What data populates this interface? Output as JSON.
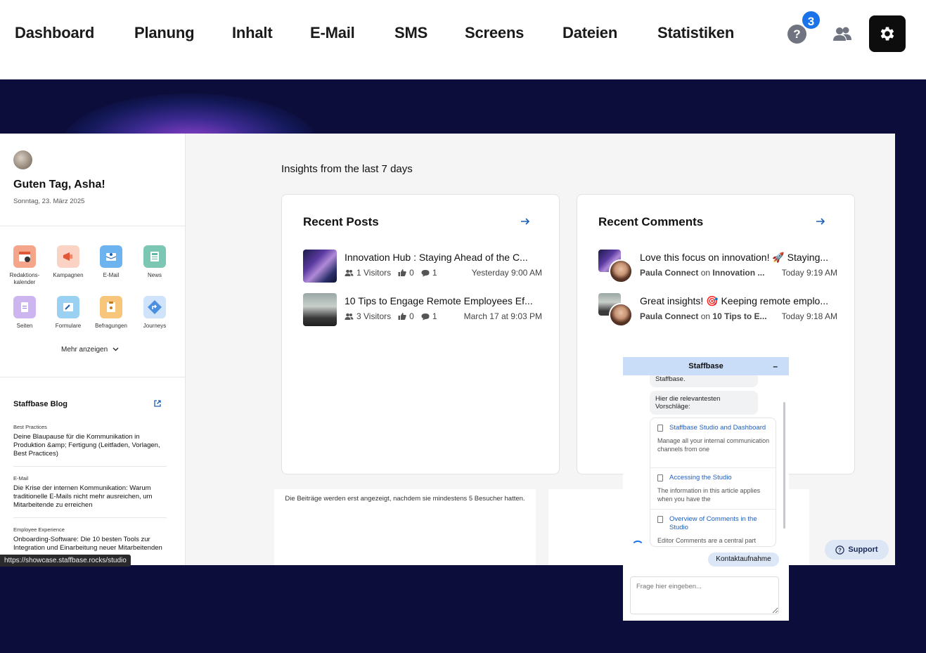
{
  "nav": {
    "items": [
      "Dashboard",
      "Planung",
      "Inhalt",
      "E-Mail",
      "SMS",
      "Screens",
      "Dateien",
      "Statistiken"
    ],
    "help_symbol": "?",
    "badge_count": "3"
  },
  "sidebar": {
    "greeting": "Guten Tag, Asha!",
    "date": "Sonntag, 23. März 2025",
    "apps": [
      {
        "label": "Redaktions-kalender",
        "icon": "calendar-icon",
        "color": "#f08a6b"
      },
      {
        "label": "Kampagnen",
        "icon": "megaphone-icon",
        "color": "#f6b9a6"
      },
      {
        "label": "E-Mail",
        "icon": "email-icon",
        "color": "#5aa7ee"
      },
      {
        "label": "News",
        "icon": "news-icon",
        "color": "#5fb9a4"
      },
      {
        "label": "Seiten",
        "icon": "page-icon",
        "color": "#b89be6"
      },
      {
        "label": "Formulare",
        "icon": "form-icon",
        "color": "#79c1ef"
      },
      {
        "label": "Befragungen",
        "icon": "survey-icon",
        "color": "#f4b65a"
      },
      {
        "label": "Journeys",
        "icon": "journey-icon",
        "color": "#4a8fe0"
      }
    ],
    "more_label": "Mehr anzeigen",
    "blog": {
      "title": "Staffbase Blog",
      "items": [
        {
          "category": "Best Practices",
          "headline": "Deine Blaupause für die Kommunikation in Produktion &amp; Fertigung (Leitfaden, Vorlagen, Best Practices)"
        },
        {
          "category": "E-Mail",
          "headline": "Die Krise der internen Kommunikation: Warum traditionelle E-Mails nicht mehr ausreichen, um Mitarbeitende zu erreichen"
        },
        {
          "category": "Employee Experience",
          "headline": "Onboarding-Software: Die 10 besten Tools zur Integration und Einarbeitung neuer Mitarbeitenden"
        }
      ]
    }
  },
  "main": {
    "insights_title": "Insights from the last 7 days",
    "recent_posts": {
      "title": "Recent Posts",
      "posts": [
        {
          "title": "Innovation Hub : Staying Ahead of the C...",
          "visitors": "1 Visitors",
          "likes": "0",
          "comments": "1",
          "time": "Yesterday 9:00 AM"
        },
        {
          "title": "10 Tips to Engage Remote Employees Ef...",
          "visitors": "3 Visitors",
          "likes": "0",
          "comments": "1",
          "time": "March 17 at 9:03 PM"
        }
      ]
    },
    "recent_comments": {
      "title": "Recent Comments",
      "comments": [
        {
          "text": "Love this focus on innovation! 🚀 Staying...",
          "author": "Paula Connect",
          "on_word": "on",
          "post": "Innovation ...",
          "time": "Today 9:19 AM"
        },
        {
          "text": "Great insights! 🎯 Keeping remote emplo...",
          "author": "Paula Connect",
          "on_word": "on",
          "post": "10 Tips to E...",
          "time": "Today 9:18 AM"
        }
      ]
    },
    "posts_notice": "Die Beiträge werden erst angezeigt, nachdem sie mindestens 5 Besucher hatten."
  },
  "support_label": "Support",
  "status_url": "https://showcase.staffbase.rocks/studio",
  "chat": {
    "title": "Staffbase",
    "minimize": "–",
    "bubble_top": "Staffbase.",
    "bubble_intro": "Hier die relevantesten Vorschläge:",
    "suggestions": [
      {
        "title": "Staffbase Studio and Dashboard",
        "desc": "Manage all your internal communication channels from one"
      },
      {
        "title": "Accessing the Studio",
        "desc": "The information in this article applies when you have the"
      },
      {
        "title": "Overview of Comments in the Studio",
        "desc": "Editor Comments are a central part"
      }
    ],
    "contact_label": "Kontaktaufnahme",
    "input_placeholder": "Frage hier eingeben..."
  }
}
